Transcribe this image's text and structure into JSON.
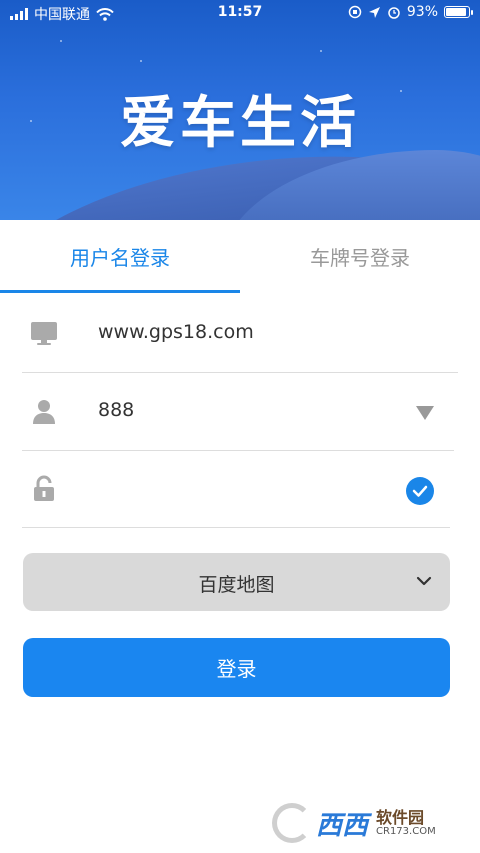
{
  "status_bar": {
    "carrier": "中国联通",
    "time": "11:57",
    "battery_percent": "93%",
    "battery_level": 0.93
  },
  "banner": {
    "title": "爱车生活"
  },
  "tabs": [
    {
      "label": "用户名登录",
      "active": true
    },
    {
      "label": "车牌号登录",
      "active": false
    }
  ],
  "form": {
    "server_value": "www.gps18.com",
    "username_value": "888",
    "password_value": "",
    "remember_password_checked": true
  },
  "map_select": {
    "selected": "百度地图"
  },
  "login_button": {
    "label": "登录"
  },
  "watermark": {
    "main": "西西",
    "sub": "软件园",
    "url": "CR173.COM"
  },
  "colors": {
    "accent": "#1a86e8",
    "button": "#1a86f0",
    "banner": "#2b6fdc",
    "select_bg": "#d9d9d9"
  }
}
